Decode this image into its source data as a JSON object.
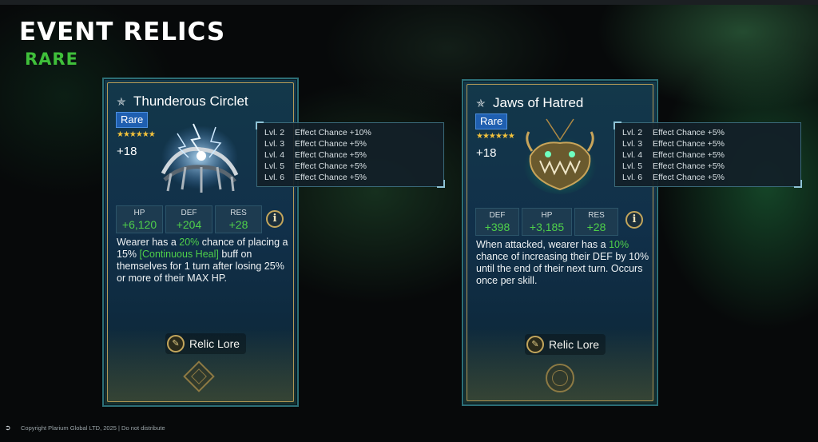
{
  "header": {
    "title": "EVENT RELICS",
    "subtitle": "RARE"
  },
  "colors": {
    "rarity_blue": "#1f5fb0",
    "stat_green": "#4fd04a",
    "accent_gold": "#c3a65c",
    "rare_header_green": "#3fbf3a"
  },
  "cards": [
    {
      "name": "Thunderous Circlet",
      "rarity": "Rare",
      "stars": "★★★★★★",
      "level": "+18",
      "stats": [
        {
          "label": "HP",
          "value": "+6,120"
        },
        {
          "label": "DEF",
          "value": "+204"
        },
        {
          "label": "RES",
          "value": "+28"
        }
      ],
      "desc": {
        "p1": "Wearer has a ",
        "g1": "20%",
        "p2": " chance of placing a 15% ",
        "g2": "[Continuous Heal]",
        "p3": " buff on themselves for 1 turn after losing 25% or more of their MAX HP."
      },
      "lore_label": "Relic Lore",
      "info_icon": "i",
      "tooltip": [
        {
          "level": "Lvl. 2",
          "effect": "Effect Chance +10%"
        },
        {
          "level": "Lvl. 3",
          "effect": "Effect Chance +5%"
        },
        {
          "level": "Lvl. 4",
          "effect": "Effect Chance +5%"
        },
        {
          "level": "Lvl. 5",
          "effect": "Effect Chance +5%"
        },
        {
          "level": "Lvl. 6",
          "effect": "Effect Chance +5%"
        }
      ]
    },
    {
      "name": "Jaws of Hatred",
      "rarity": "Rare",
      "stars": "★★★★★★",
      "level": "+18",
      "stats": [
        {
          "label": "DEF",
          "value": "+398"
        },
        {
          "label": "HP",
          "value": "+3,185"
        },
        {
          "label": "RES",
          "value": "+28"
        }
      ],
      "desc": {
        "p1": "When attacked, wearer has a ",
        "g1": "10%",
        "p2": " chance of increasing their DEF by 10% until the end of their next turn. Occurs once per skill.",
        "g2": "",
        "p3": ""
      },
      "lore_label": "Relic Lore",
      "info_icon": "i",
      "tooltip": [
        {
          "level": "Lvl. 2",
          "effect": "Effect Chance +5%"
        },
        {
          "level": "Lvl. 3",
          "effect": "Effect Chance +5%"
        },
        {
          "level": "Lvl. 4",
          "effect": "Effect Chance +5%"
        },
        {
          "level": "Lvl. 5",
          "effect": "Effect Chance +5%"
        },
        {
          "level": "Lvl. 6",
          "effect": "Effect Chance +5%"
        }
      ]
    }
  ],
  "footer": {
    "text": "Copyright Plarium Global LTD, 2025 | Do not distribute"
  }
}
